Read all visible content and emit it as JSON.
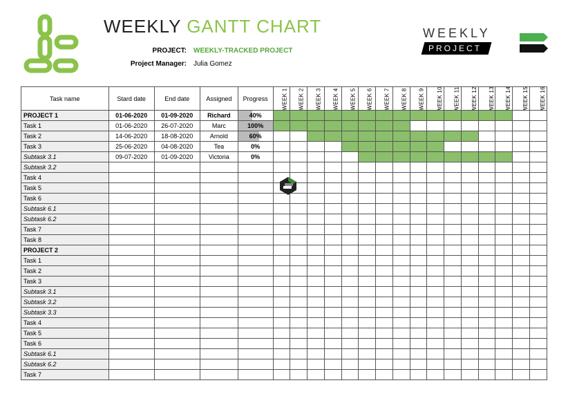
{
  "title": {
    "w1": "WEEKLY",
    "w2": "GANTT CHART"
  },
  "meta": {
    "project_label": "PROJECT:",
    "project_value": "WEEKLY-TRACKED PROJECT",
    "pm_label": "Project Manager:",
    "pm_value": "Julia Gomez"
  },
  "logo_right": {
    "weekly": "WEEKLY",
    "project": "PROJECT"
  },
  "columns": {
    "task": "Task name",
    "start": "Stard date",
    "end": "End date",
    "assigned": "Assigned",
    "progress": "Progress"
  },
  "weeks": [
    "WEEK 1",
    "WEEK 2",
    "WEEK 3",
    "WEEK 4",
    "WEEK 5",
    "WEEK 6",
    "WEEK 7",
    "WEEK 8",
    "WEEK 9",
    "WEEK 10",
    "WEEK 11",
    "WEEK 12",
    "WEEK 13",
    "WEEK 14",
    "WEEK 15",
    "WEEK 16"
  ],
  "rows": [
    {
      "name": "PROJECT 1",
      "style": "bold",
      "start": "01-06-2020",
      "end": "01-09-2020",
      "assigned": "Richard",
      "progress": "40%",
      "progress_pct": 40,
      "weeks": [
        1,
        2,
        3,
        4,
        5,
        6,
        7,
        8,
        9,
        10,
        11,
        12,
        13,
        14
      ]
    },
    {
      "name": "Task 1",
      "style": "",
      "start": "01-06-2020",
      "end": "26-07-2020",
      "assigned": "Marc",
      "progress": "100%",
      "progress_pct": 100,
      "weeks": [
        1,
        2,
        3,
        4,
        5,
        6,
        7,
        8
      ]
    },
    {
      "name": "Task 2",
      "style": "",
      "start": "14-06-2020",
      "end": "18-08-2020",
      "assigned": "Arnold",
      "progress": "60%",
      "progress_pct": 60,
      "weeks": [
        3,
        4,
        5,
        6,
        7,
        8,
        9,
        10,
        11,
        12
      ]
    },
    {
      "name": "Task 3",
      "style": "",
      "start": "25-06-2020",
      "end": "04-08-2020",
      "assigned": "Tea",
      "progress": "0%",
      "progress_pct": 0,
      "weeks": [
        5,
        6,
        7,
        8,
        9,
        10
      ]
    },
    {
      "name": "Subtask 3.1",
      "style": "italic",
      "start": "09-07-2020",
      "end": "01-09-2020",
      "assigned": "Victoria",
      "progress": "0%",
      "progress_pct": 0,
      "weeks": [
        6,
        7,
        8,
        9,
        10,
        11,
        12,
        13,
        14
      ]
    },
    {
      "name": "Subtask 3.2",
      "style": "italic",
      "start": "",
      "end": "",
      "assigned": "",
      "progress": "",
      "progress_pct": null,
      "weeks": []
    },
    {
      "name": "Task 4",
      "style": "",
      "start": "",
      "end": "",
      "assigned": "",
      "progress": "",
      "progress_pct": null,
      "weeks": []
    },
    {
      "name": "Task 5",
      "style": "",
      "start": "",
      "end": "",
      "assigned": "",
      "progress": "",
      "progress_pct": null,
      "weeks": []
    },
    {
      "name": "Task 6",
      "style": "",
      "start": "",
      "end": "",
      "assigned": "",
      "progress": "",
      "progress_pct": null,
      "weeks": []
    },
    {
      "name": "Subtask 6.1",
      "style": "italic",
      "start": "",
      "end": "",
      "assigned": "",
      "progress": "",
      "progress_pct": null,
      "weeks": []
    },
    {
      "name": "Subtask 6.2",
      "style": "italic",
      "start": "",
      "end": "",
      "assigned": "",
      "progress": "",
      "progress_pct": null,
      "weeks": []
    },
    {
      "name": "Task 7",
      "style": "",
      "start": "",
      "end": "",
      "assigned": "",
      "progress": "",
      "progress_pct": null,
      "weeks": []
    },
    {
      "name": "Task 8",
      "style": "",
      "start": "",
      "end": "",
      "assigned": "",
      "progress": "",
      "progress_pct": null,
      "weeks": []
    },
    {
      "name": "PROJECT 2",
      "style": "bold",
      "start": "",
      "end": "",
      "assigned": "",
      "progress": "",
      "progress_pct": null,
      "weeks": []
    },
    {
      "name": "Task 1",
      "style": "",
      "start": "",
      "end": "",
      "assigned": "",
      "progress": "",
      "progress_pct": null,
      "weeks": []
    },
    {
      "name": "Task 2",
      "style": "",
      "start": "",
      "end": "",
      "assigned": "",
      "progress": "",
      "progress_pct": null,
      "weeks": []
    },
    {
      "name": "Task 3",
      "style": "",
      "start": "",
      "end": "",
      "assigned": "",
      "progress": "",
      "progress_pct": null,
      "weeks": []
    },
    {
      "name": "Subtask 3.1",
      "style": "italic",
      "start": "",
      "end": "",
      "assigned": "",
      "progress": "",
      "progress_pct": null,
      "weeks": []
    },
    {
      "name": "Subtask 3.2",
      "style": "italic",
      "start": "",
      "end": "",
      "assigned": "",
      "progress": "",
      "progress_pct": null,
      "weeks": []
    },
    {
      "name": "Subtask 3.3",
      "style": "italic",
      "start": "",
      "end": "",
      "assigned": "",
      "progress": "",
      "progress_pct": null,
      "weeks": []
    },
    {
      "name": "Task 4",
      "style": "",
      "start": "",
      "end": "",
      "assigned": "",
      "progress": "",
      "progress_pct": null,
      "weeks": []
    },
    {
      "name": "Task 5",
      "style": "",
      "start": "",
      "end": "",
      "assigned": "",
      "progress": "",
      "progress_pct": null,
      "weeks": []
    },
    {
      "name": "Task 6",
      "style": "",
      "start": "",
      "end": "",
      "assigned": "",
      "progress": "",
      "progress_pct": null,
      "weeks": []
    },
    {
      "name": "Subtask 6.1",
      "style": "italic",
      "start": "",
      "end": "",
      "assigned": "",
      "progress": "",
      "progress_pct": null,
      "weeks": []
    },
    {
      "name": "Subtask 6.2",
      "style": "italic",
      "start": "",
      "end": "",
      "assigned": "",
      "progress": "",
      "progress_pct": null,
      "weeks": []
    },
    {
      "name": "Task 7",
      "style": "",
      "start": "",
      "end": "",
      "assigned": "",
      "progress": "",
      "progress_pct": null,
      "weeks": []
    }
  ],
  "chart_data": {
    "type": "table",
    "title": "Weekly Gantt Chart",
    "xlabel": "Week",
    "ylabel": "Task",
    "x_categories": [
      "WEEK 1",
      "WEEK 2",
      "WEEK 3",
      "WEEK 4",
      "WEEK 5",
      "WEEK 6",
      "WEEK 7",
      "WEEK 8",
      "WEEK 9",
      "WEEK 10",
      "WEEK 11",
      "WEEK 12",
      "WEEK 13",
      "WEEK 14",
      "WEEK 15",
      "WEEK 16"
    ],
    "series": [
      {
        "name": "PROJECT 1",
        "start": "01-06-2020",
        "end": "01-09-2020",
        "assigned": "Richard",
        "progress": 40,
        "span": [
          1,
          14
        ]
      },
      {
        "name": "Task 1",
        "start": "01-06-2020",
        "end": "26-07-2020",
        "assigned": "Marc",
        "progress": 100,
        "span": [
          1,
          8
        ]
      },
      {
        "name": "Task 2",
        "start": "14-06-2020",
        "end": "18-08-2020",
        "assigned": "Arnold",
        "progress": 60,
        "span": [
          3,
          12
        ]
      },
      {
        "name": "Task 3",
        "start": "25-06-2020",
        "end": "04-08-2020",
        "assigned": "Tea",
        "progress": 0,
        "span": [
          5,
          10
        ]
      },
      {
        "name": "Subtask 3.1",
        "start": "09-07-2020",
        "end": "01-09-2020",
        "assigned": "Victoria",
        "progress": 0,
        "span": [
          6,
          14
        ]
      }
    ],
    "colors": {
      "bar_fill": "#8bbf6b",
      "progress_fill": "#bbbbbb"
    }
  }
}
